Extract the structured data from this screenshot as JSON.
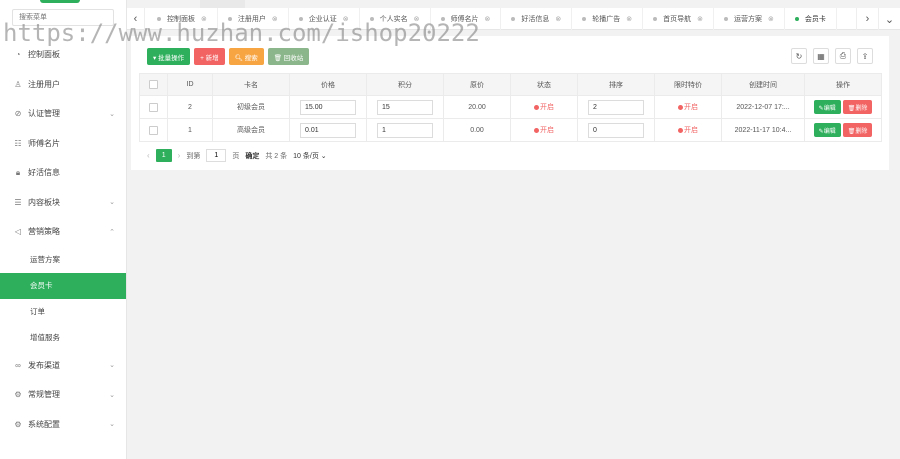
{
  "sidebar": {
    "search_placeholder": "搜索菜单",
    "menu": [
      {
        "icon": "dashboard-icon",
        "glyph": "◔",
        "label": "控制面板",
        "caret": ""
      },
      {
        "icon": "user-icon",
        "glyph": "♙",
        "label": "注册用户",
        "caret": ""
      },
      {
        "icon": "check-circle-icon",
        "glyph": "⊘",
        "label": "认证管理",
        "caret": "⌄"
      },
      {
        "icon": "card-icon",
        "glyph": "☷",
        "label": "师傅名片",
        "caret": ""
      },
      {
        "icon": "lock-icon",
        "glyph": "🔒︎",
        "label": "好活信息",
        "caret": ""
      },
      {
        "icon": "sliders-icon",
        "glyph": "☰",
        "label": "内容板块",
        "caret": "⌄"
      },
      {
        "icon": "send-icon",
        "glyph": "◁",
        "label": "营销策略",
        "caret": "⌃"
      }
    ],
    "submenu": [
      {
        "label": "运营方案",
        "active": false
      },
      {
        "label": "会员卡",
        "active": true
      },
      {
        "label": "订单",
        "active": false
      },
      {
        "label": "增值服务",
        "active": false
      }
    ],
    "menu_bottom": [
      {
        "icon": "link-icon",
        "glyph": "∞",
        "label": "发布渠道",
        "caret": "⌄"
      },
      {
        "icon": "settings-icon",
        "glyph": "⚙",
        "label": "常规管理",
        "caret": "⌄"
      },
      {
        "icon": "gear-icon",
        "glyph": "⚙",
        "label": "系统配置",
        "caret": "⌄"
      }
    ]
  },
  "tabs": [
    {
      "label": "控制面板",
      "active": false
    },
    {
      "label": "注册用户",
      "active": false
    },
    {
      "label": "企业认证",
      "active": false
    },
    {
      "label": "个人实名",
      "active": false
    },
    {
      "label": "师傅名片",
      "active": false
    },
    {
      "label": "好活信息",
      "active": false
    },
    {
      "label": "轮播广告",
      "active": false
    },
    {
      "label": "首页导航",
      "active": false
    },
    {
      "label": "运营方案",
      "active": false
    },
    {
      "label": "会员卡",
      "active": true
    }
  ],
  "toolbar": {
    "batch": "▾ 批量操作",
    "add": "+ 新增",
    "search": "🔍︎ 搜索",
    "recycle": "🗑︎ 回收站"
  },
  "table": {
    "headers": [
      "ID",
      "卡名",
      "价格",
      "积分",
      "原价",
      "状态",
      "排序",
      "限时特价",
      "创建时间",
      "操作"
    ],
    "rows": [
      {
        "id": "2",
        "name": "初级会员",
        "price": "15.00",
        "points": "15",
        "original": "20.00",
        "status": "开启",
        "sort": "2",
        "special": "开启",
        "created": "2022-12-07 17:..."
      },
      {
        "id": "1",
        "name": "高级会员",
        "price": "0.01",
        "points": "1",
        "original": "0.00",
        "status": "开启",
        "sort": "0",
        "special": "开启",
        "created": "2022-11-17 10:4..."
      }
    ],
    "edit_label": "✎编辑",
    "delete_label": "🗑︎删除"
  },
  "pager": {
    "current": "1",
    "goto_label": "到第",
    "goto_value": "1",
    "page_unit": "页",
    "confirm": "确定",
    "total": "共 2 条",
    "page_size": "10 条/页 ⌄"
  },
  "watermark": "https://www.huzhan.com/ishop20222"
}
